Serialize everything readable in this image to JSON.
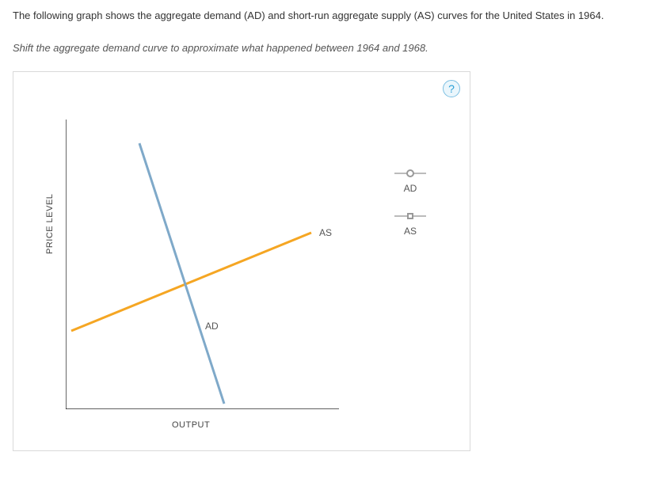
{
  "intro": "The following graph shows the aggregate demand (AD) and short-run aggregate supply (AS) curves for the United States in 1964.",
  "instructions": "Shift the aggregate demand curve to approximate what happened between 1964 and 1968.",
  "help": "?",
  "axes": {
    "ylabel": "PRICE LEVEL",
    "xlabel": "OUTPUT"
  },
  "curves": {
    "ad_label": "AD",
    "as_label": "AS"
  },
  "legend": {
    "ad": "AD",
    "as": "AS"
  },
  "chart_data": {
    "type": "line",
    "title": "",
    "xlabel": "OUTPUT",
    "ylabel": "PRICE LEVEL",
    "xlim": [
      0,
      10
    ],
    "ylim": [
      0,
      10
    ],
    "series": [
      {
        "name": "AD",
        "color": "#7fa9c9",
        "x": [
          2.7,
          5.8
        ],
        "y": [
          9.2,
          0.2
        ]
      },
      {
        "name": "AS",
        "color": "#f5a623",
        "x": [
          0.2,
          9.0
        ],
        "y": [
          2.7,
          6.1
        ]
      }
    ],
    "annotations": [
      {
        "text": "AD",
        "x": 5.0,
        "y": 2.9
      },
      {
        "text": "AS",
        "x": 9.4,
        "y": 6.0
      }
    ]
  }
}
